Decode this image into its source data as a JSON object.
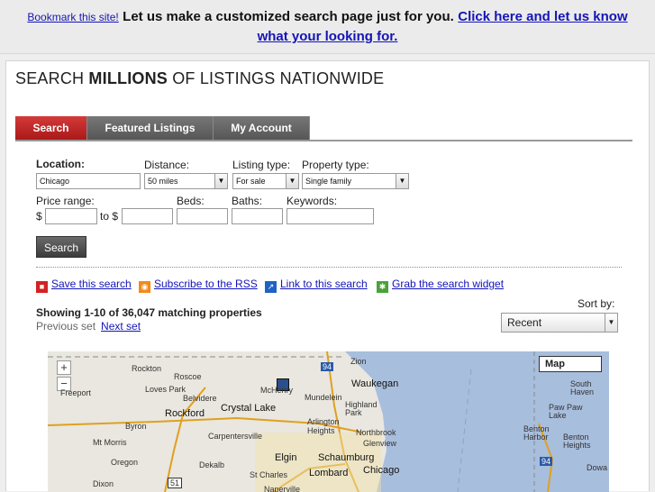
{
  "topbar": {
    "bookmark": "Bookmark this site!",
    "pitch": "Let us make a customized search page just for you.",
    "cta_line1": "Click here and let us know",
    "cta_line2": "what your looking for."
  },
  "headline": {
    "pre": "SEARCH ",
    "strong": "MILLIONS",
    "post": " OF LISTINGS NATIONWIDE"
  },
  "tabs": [
    {
      "label": "Search",
      "active": true
    },
    {
      "label": "Featured Listings"
    },
    {
      "label": "My Account"
    }
  ],
  "form": {
    "location_label": "Location:",
    "location_value": "Chicago",
    "distance_label": "Distance:",
    "distance_value": "50 miles",
    "listing_type_label": "Listing type:",
    "listing_type_value": "For sale",
    "property_type_label": "Property type:",
    "property_type_value": "Single family",
    "price_range_label": "Price range:",
    "price_prefix": "$",
    "price_to": "to $",
    "beds_label": "Beds:",
    "baths_label": "Baths:",
    "keywords_label": "Keywords:",
    "search_button": "Search"
  },
  "tools": {
    "save": "Save this search",
    "rss": "Subscribe to the RSS",
    "link": "Link to this search",
    "widget": "Grab the search widget"
  },
  "results": {
    "showing": "Showing 1-10 of 36,047 matching properties",
    "previous": "Previous set",
    "next": "Next set"
  },
  "sort": {
    "label": "Sort by:",
    "value": "Recent"
  },
  "map": {
    "type_button": "Map",
    "zoom_in": "+",
    "zoom_out": "−",
    "cities": [
      "Rockton",
      "Roscoe",
      "Loves Park",
      "Freeport",
      "Belvidere",
      "Rockford",
      "Byron",
      "Mt Morris",
      "Oregon",
      "Dekalb",
      "Dixon",
      "McHenry",
      "Zion",
      "Waukegan",
      "Mundelein",
      "Crystal Lake",
      "Highland Park",
      "Arlington Heights",
      "Northbrook",
      "Glenview",
      "Carpentersville",
      "Elgin",
      "Schaumburg",
      "St Charles",
      "Lombard",
      "Chicago",
      "Naperville",
      "South Haven",
      "Paw Paw Lake",
      "Benton Harbor",
      "Benton Heights",
      "Dowa"
    ],
    "routes": [
      "94",
      "51",
      "94"
    ]
  }
}
